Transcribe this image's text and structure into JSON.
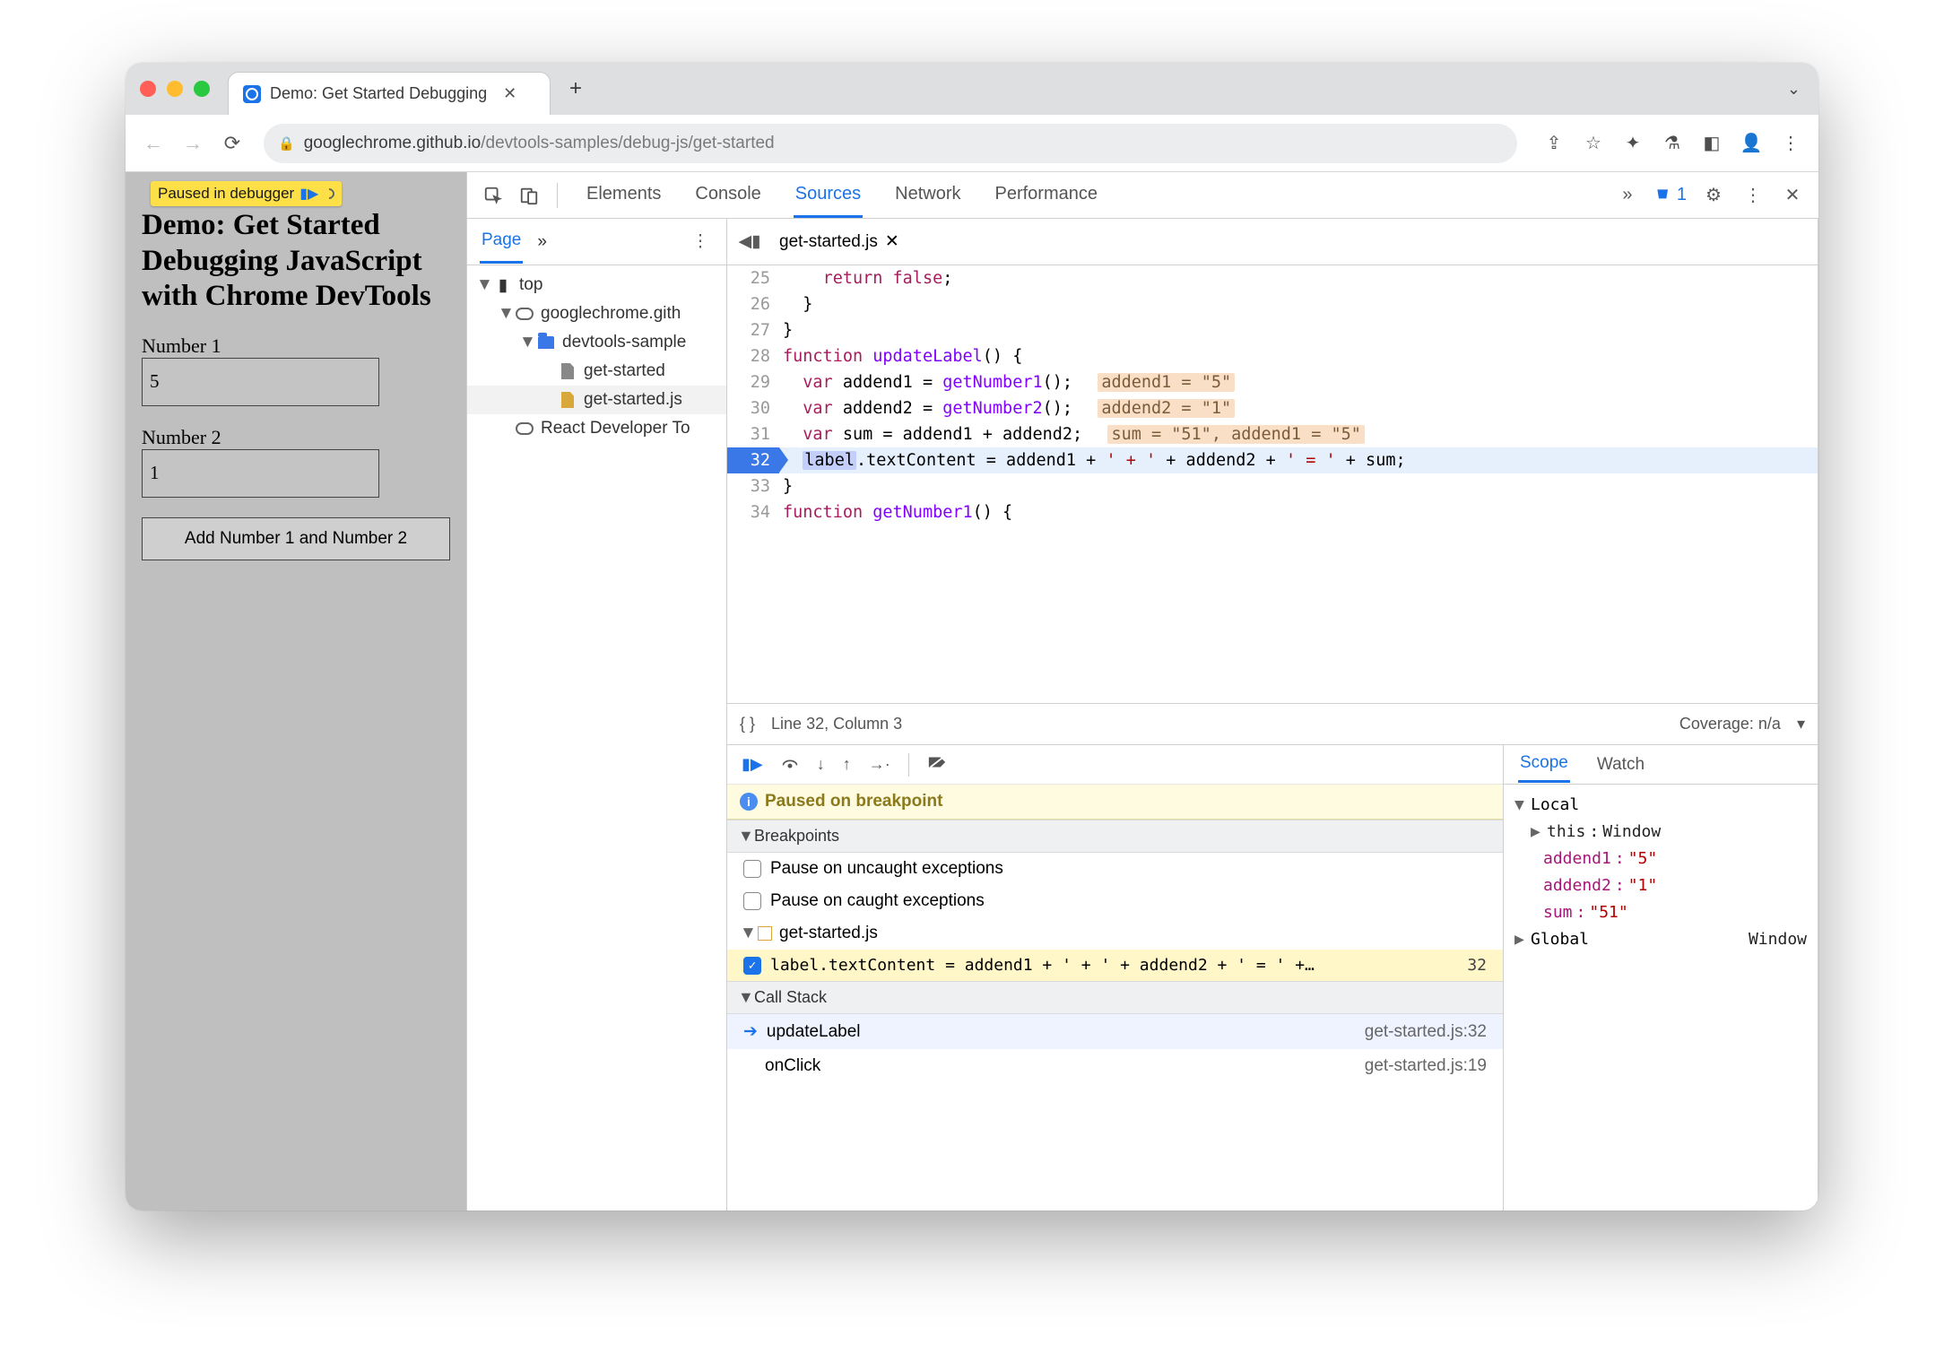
{
  "tab": {
    "title": "Demo: Get Started Debugging"
  },
  "url": {
    "host": "googlechrome.github.io",
    "path": "/devtools-samples/debug-js/get-started"
  },
  "overlay": {
    "text": "Paused in debugger"
  },
  "page": {
    "title": "Demo: Get Started Debugging JavaScript with Chrome DevTools",
    "label1": "Number 1",
    "value1": "5",
    "label2": "Number 2",
    "value2": "1",
    "button": "Add Number 1 and Number 2"
  },
  "devtools": {
    "panels": [
      "Elements",
      "Console",
      "Sources",
      "Network",
      "Performance"
    ],
    "active_panel": "Sources",
    "issues_count": "1",
    "navigator": {
      "tab": "Page",
      "items": [
        {
          "depth": 0,
          "icon": "frame",
          "label": "top",
          "expanded": true
        },
        {
          "depth": 1,
          "icon": "cloud",
          "label": "googlechrome.gith",
          "expanded": true,
          "indent": "ind0"
        },
        {
          "depth": 2,
          "icon": "folder",
          "label": "devtools-sample",
          "expanded": true
        },
        {
          "depth": 3,
          "icon": "file",
          "label": "get-started"
        },
        {
          "depth": 3,
          "icon": "js",
          "label": "get-started.js",
          "selected": true
        },
        {
          "depth": 1,
          "icon": "cloud",
          "label": "React Developer To"
        }
      ]
    },
    "editor": {
      "filename": "get-started.js",
      "lines": [
        {
          "n": 25,
          "text": "    return false;",
          "tokens": [
            [
              "    ",
              ""
            ],
            [
              "return",
              "kw"
            ],
            [
              " ",
              ""
            ],
            [
              "false",
              "kw"
            ],
            [
              ";",
              ""
            ]
          ]
        },
        {
          "n": 26,
          "text": "  }",
          "tokens": [
            [
              "  }",
              ""
            ]
          ]
        },
        {
          "n": 27,
          "text": "}",
          "tokens": [
            [
              "}",
              ""
            ]
          ]
        },
        {
          "n": 28,
          "text": "function updateLabel() {",
          "tokens": [
            [
              "function",
              "kw"
            ],
            [
              " ",
              ""
            ],
            [
              "updateLabel",
              "fn"
            ],
            [
              "() {",
              ""
            ]
          ]
        },
        {
          "n": 29,
          "text": "  var addend1 = getNumber1();",
          "tokens": [
            [
              "  ",
              ""
            ],
            [
              "var",
              "kw"
            ],
            [
              " addend1 = ",
              ""
            ],
            [
              "getNumber1",
              "fn"
            ],
            [
              "();",
              ""
            ]
          ],
          "hint": "addend1 = \"5\""
        },
        {
          "n": 30,
          "text": "  var addend2 = getNumber2();",
          "tokens": [
            [
              "  ",
              ""
            ],
            [
              "var",
              "kw"
            ],
            [
              " addend2 = ",
              ""
            ],
            [
              "getNumber2",
              "fn"
            ],
            [
              "();",
              ""
            ]
          ],
          "hint": "addend2 = \"1\""
        },
        {
          "n": 31,
          "text": "  var sum = addend1 + addend2;",
          "tokens": [
            [
              "  ",
              ""
            ],
            [
              "var",
              "kw"
            ],
            [
              " sum = addend1 + addend2;",
              ""
            ]
          ],
          "hint": "sum = \"51\", addend1 = \"5\""
        },
        {
          "n": 32,
          "text": "  label.textContent = addend1 + ' + ' + addend2 + ' = ' + sum;",
          "current": true
        },
        {
          "n": 33,
          "text": "}",
          "tokens": [
            [
              "}",
              ""
            ]
          ]
        },
        {
          "n": 34,
          "text": "function getNumber1() {",
          "tokens": [
            [
              "function",
              "kw"
            ],
            [
              " ",
              ""
            ],
            [
              "getNumber1",
              "fn"
            ],
            [
              "() {",
              ""
            ]
          ]
        }
      ],
      "status": {
        "cursor": "Line 32, Column 3",
        "coverage": "Coverage: n/a"
      }
    },
    "debugger": {
      "paused_reason": "Paused on breakpoint",
      "breakpoints": {
        "pause_uncaught": "Pause on uncaught exceptions",
        "pause_caught": "Pause on caught exceptions",
        "file": "get-started.js",
        "entry": "label.textContent = addend1 + ' + ' + addend2 + ' = ' +…",
        "entry_line": "32"
      },
      "sections": {
        "breakpoints": "Breakpoints",
        "callstack": "Call Stack"
      },
      "call_stack": [
        {
          "name": "updateLabel",
          "loc": "get-started.js:32",
          "active": true
        },
        {
          "name": "onClick",
          "loc": "get-started.js:19"
        }
      ]
    },
    "scope": {
      "tabs": [
        "Scope",
        "Watch"
      ],
      "local_label": "Local",
      "this": {
        "name": "this",
        "type": "Window"
      },
      "vars": [
        {
          "name": "addend1",
          "value": "\"5\""
        },
        {
          "name": "addend2",
          "value": "\"1\""
        },
        {
          "name": "sum",
          "value": "\"51\""
        }
      ],
      "global": {
        "label": "Global",
        "type": "Window"
      }
    }
  }
}
